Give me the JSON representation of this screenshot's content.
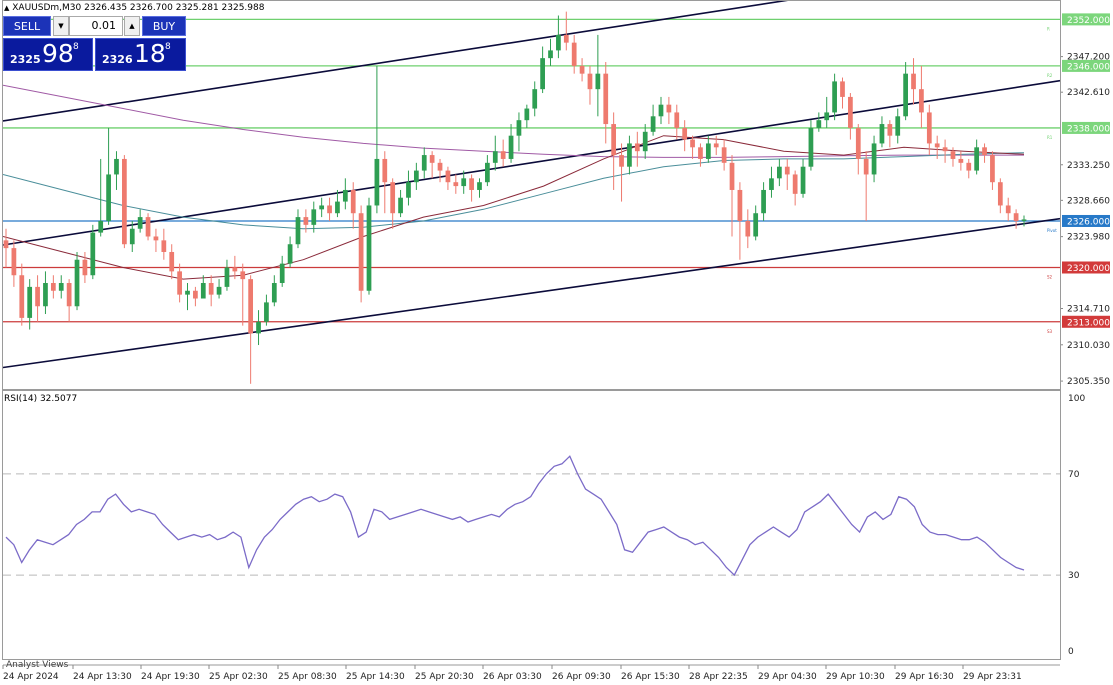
{
  "header": {
    "symbol_line": "XAUUSDm,M30  2326.435 2326.700 2325.281 2325.988"
  },
  "trade_panel": {
    "sell_label": "SELL",
    "buy_label": "BUY",
    "volume": "0.01",
    "sell_price_small": "2325",
    "sell_price_big": "98",
    "sell_price_sup": "8",
    "buy_price_small": "2326",
    "buy_price_big": "18",
    "buy_price_sup": "8"
  },
  "rsi_title": "RSI(14) 32.5077",
  "footer": {
    "analyst_views": "Analyst Views"
  },
  "colors": {
    "bull": "#2e9e52",
    "bear": "#ee7a6e",
    "channel": "#0b0b3a",
    "resistance": "#6fd06f",
    "current": "#2779c8",
    "support": "#cc3b3b",
    "ma_purple": "#a05aa5",
    "ma_maroon": "#8a2a3a",
    "ma_teal": "#4a8e9a",
    "rsi": "#7b6bc8",
    "label_current_bg": "#2779c8",
    "label_resistance_bg": "#7cd67c",
    "label_support_bg": "#d23a3a"
  },
  "chart_data": {
    "type": "candlestick",
    "symbol": "XAUUSDm",
    "timeframe": "M30",
    "price_axis": {
      "ticks": [
        2347.2,
        2342.61,
        2333.25,
        2328.66,
        2323.98,
        2314.71,
        2310.03,
        2305.35
      ],
      "ylim": [
        2304.2,
        2354.5
      ]
    },
    "x_ticks": [
      "24 Apr 2024",
      "24 Apr 13:30",
      "24 Apr 19:30",
      "25 Apr 02:30",
      "25 Apr 08:30",
      "25 Apr 14:30",
      "25 Apr 20:30",
      "26 Apr 03:30",
      "26 Apr 09:30",
      "26 Apr 15:30",
      "28 Apr 22:35",
      "29 Apr 04:30",
      "29 Apr 10:30",
      "29 Apr 16:30",
      "29 Apr 23:31"
    ],
    "horizontal_levels": [
      {
        "price": 2352.0,
        "label": "2352.000",
        "kind": "resistance",
        "tag": "R"
      },
      {
        "price": 2346.0,
        "label": "2346.000",
        "kind": "resistance",
        "tag": "R2"
      },
      {
        "price": 2338.0,
        "label": "2338.000",
        "kind": "resistance",
        "tag": "R1"
      },
      {
        "price": 2326.0,
        "label": "2326.000",
        "kind": "current",
        "tag": "Pivot"
      },
      {
        "price": 2320.0,
        "label": "2320.000",
        "kind": "support",
        "tag": "S2"
      },
      {
        "price": 2313.0,
        "label": "2313.000",
        "kind": "support",
        "tag": "S3"
      }
    ],
    "channel_lines": [
      {
        "x0": 0,
        "p0": 2338.9,
        "x1": 165,
        "p1": 2355.3
      },
      {
        "x0": 0,
        "p0": 2322.9,
        "x1": 211,
        "p1": 2344.1
      },
      {
        "x0": 0,
        "p0": 2307.1,
        "x1": 211,
        "p1": 2326.3
      }
    ],
    "candles": [
      [
        2323.5,
        2322.5,
        2325.0,
        2320.0
      ],
      [
        2322.5,
        2319.0,
        2323.5,
        2317.5
      ],
      [
        2319.0,
        2313.5,
        2320.5,
        2312.5
      ],
      [
        2313.5,
        2317.5,
        2318.5,
        2312.0
      ],
      [
        2317.5,
        2315.0,
        2319.0,
        2313.0
      ],
      [
        2315.0,
        2318.0,
        2319.5,
        2314.0
      ],
      [
        2318.0,
        2317.0,
        2319.0,
        2316.0
      ],
      [
        2317.0,
        2318.0,
        2319.0,
        2316.0
      ],
      [
        2318.0,
        2315.0,
        2318.5,
        2313.0
      ],
      [
        2315.0,
        2321.0,
        2322.0,
        2314.5
      ],
      [
        2321.0,
        2319.0,
        2322.0,
        2318.0
      ],
      [
        2319.0,
        2324.5,
        2325.5,
        2318.5
      ],
      [
        2324.5,
        2326.0,
        2334.0,
        2324.0
      ],
      [
        2326.0,
        2332.0,
        2338.0,
        2325.5
      ],
      [
        2332.0,
        2334.0,
        2335.0,
        2330.0
      ],
      [
        2334.0,
        2323.0,
        2334.5,
        2322.5
      ],
      [
        2323.0,
        2325.0,
        2326.0,
        2322.0
      ],
      [
        2325.0,
        2326.5,
        2327.5,
        2324.5
      ],
      [
        2326.5,
        2324.0,
        2327.0,
        2323.5
      ],
      [
        2324.0,
        2323.5,
        2325.0,
        2322.0
      ],
      [
        2323.5,
        2322.0,
        2325.0,
        2321.0
      ],
      [
        2322.0,
        2319.5,
        2323.0,
        2318.5
      ],
      [
        2319.5,
        2316.5,
        2320.5,
        2315.5
      ],
      [
        2316.5,
        2317.0,
        2318.0,
        2314.5
      ],
      [
        2317.0,
        2316.0,
        2317.5,
        2315.0
      ],
      [
        2316.0,
        2318.0,
        2319.0,
        2316.0
      ],
      [
        2318.0,
        2316.5,
        2319.0,
        2315.0
      ],
      [
        2316.5,
        2317.5,
        2318.5,
        2316.0
      ],
      [
        2317.5,
        2320.0,
        2321.0,
        2317.0
      ],
      [
        2320.0,
        2319.5,
        2321.5,
        2318.5
      ],
      [
        2319.5,
        2318.5,
        2320.5,
        2312.5
      ],
      [
        2318.5,
        2311.5,
        2319.0,
        2305.0
      ],
      [
        2311.5,
        2313.0,
        2314.5,
        2310.0
      ],
      [
        2313.0,
        2315.5,
        2316.5,
        2312.5
      ],
      [
        2315.5,
        2318.0,
        2319.0,
        2315.0
      ],
      [
        2318.0,
        2320.5,
        2321.5,
        2317.5
      ],
      [
        2320.5,
        2323.0,
        2324.0,
        2320.0
      ],
      [
        2323.0,
        2326.5,
        2327.5,
        2322.5
      ],
      [
        2326.5,
        2325.5,
        2327.5,
        2324.5
      ],
      [
        2325.5,
        2327.5,
        2328.5,
        2324.5
      ],
      [
        2327.5,
        2328.0,
        2329.0,
        2326.5
      ],
      [
        2328.0,
        2327.0,
        2329.0,
        2326.0
      ],
      [
        2327.0,
        2328.5,
        2330.0,
        2326.5
      ],
      [
        2328.5,
        2330.0,
        2331.5,
        2327.5
      ],
      [
        2330.0,
        2327.0,
        2331.0,
        2325.0
      ],
      [
        2327.0,
        2317.0,
        2328.0,
        2315.5
      ],
      [
        2317.0,
        2328.0,
        2329.0,
        2316.5
      ],
      [
        2328.0,
        2334.0,
        2346.0,
        2327.0
      ],
      [
        2334.0,
        2331.0,
        2335.0,
        2327.0
      ],
      [
        2331.0,
        2327.0,
        2331.5,
        2325.0
      ],
      [
        2327.0,
        2329.0,
        2330.0,
        2326.5
      ],
      [
        2329.0,
        2331.0,
        2332.5,
        2328.0
      ],
      [
        2331.0,
        2332.5,
        2333.5,
        2330.0
      ],
      [
        2332.5,
        2334.5,
        2335.5,
        2331.5
      ],
      [
        2334.5,
        2333.5,
        2335.0,
        2331.5
      ],
      [
        2333.5,
        2332.5,
        2334.0,
        2331.0
      ],
      [
        2332.5,
        2331.0,
        2333.0,
        2330.0
      ],
      [
        2331.0,
        2330.5,
        2332.0,
        2329.5
      ],
      [
        2330.5,
        2331.5,
        2332.5,
        2329.5
      ],
      [
        2331.5,
        2330.0,
        2332.0,
        2328.5
      ],
      [
        2330.0,
        2331.0,
        2331.5,
        2329.0
      ],
      [
        2331.0,
        2333.5,
        2334.5,
        2330.5
      ],
      [
        2333.5,
        2335.0,
        2337.0,
        2332.5
      ],
      [
        2335.0,
        2334.0,
        2336.5,
        2333.0
      ],
      [
        2334.0,
        2337.0,
        2338.5,
        2333.5
      ],
      [
        2337.0,
        2339.0,
        2340.0,
        2335.0
      ],
      [
        2339.0,
        2340.5,
        2341.0,
        2338.0
      ],
      [
        2340.5,
        2343.0,
        2344.0,
        2339.5
      ],
      [
        2343.0,
        2347.0,
        2348.5,
        2342.5
      ],
      [
        2347.0,
        2348.0,
        2349.5,
        2346.0
      ],
      [
        2348.0,
        2350.0,
        2352.5,
        2347.0
      ],
      [
        2350.0,
        2349.0,
        2353.0,
        2348.0
      ],
      [
        2349.0,
        2346.0,
        2350.0,
        2345.0
      ],
      [
        2346.0,
        2345.0,
        2347.0,
        2344.0
      ],
      [
        2345.0,
        2343.0,
        2346.0,
        2341.0
      ],
      [
        2343.0,
        2345.0,
        2350.0,
        2339.5
      ],
      [
        2345.0,
        2338.5,
        2346.5,
        2336.0
      ],
      [
        2338.5,
        2334.5,
        2340.0,
        2330.0
      ],
      [
        2334.5,
        2333.0,
        2336.0,
        2328.5
      ],
      [
        2333.0,
        2336.0,
        2337.0,
        2332.0
      ],
      [
        2336.0,
        2335.0,
        2337.5,
        2333.0
      ],
      [
        2335.0,
        2337.5,
        2338.5,
        2334.0
      ],
      [
        2337.5,
        2339.5,
        2341.0,
        2337.0
      ],
      [
        2339.5,
        2341.0,
        2342.0,
        2338.5
      ],
      [
        2341.0,
        2340.0,
        2342.0,
        2338.5
      ],
      [
        2340.0,
        2338.0,
        2341.0,
        2336.5
      ],
      [
        2338.0,
        2336.5,
        2339.0,
        2335.0
      ],
      [
        2336.5,
        2335.5,
        2337.0,
        2334.0
      ],
      [
        2335.5,
        2334.0,
        2336.0,
        2333.0
      ],
      [
        2334.0,
        2336.0,
        2337.0,
        2333.5
      ],
      [
        2336.0,
        2335.5,
        2337.0,
        2334.5
      ],
      [
        2335.5,
        2333.5,
        2336.5,
        2332.5
      ],
      [
        2333.5,
        2330.0,
        2334.5,
        2324.0
      ],
      [
        2330.0,
        2326.0,
        2331.0,
        2321.0
      ],
      [
        2326.0,
        2324.0,
        2327.5,
        2322.5
      ],
      [
        2324.0,
        2327.0,
        2328.0,
        2323.5
      ],
      [
        2327.0,
        2330.0,
        2331.0,
        2326.0
      ],
      [
        2330.0,
        2331.5,
        2333.0,
        2329.0
      ],
      [
        2331.5,
        2333.0,
        2334.0,
        2330.5
      ],
      [
        2333.0,
        2332.0,
        2334.0,
        2330.0
      ],
      [
        2332.0,
        2329.5,
        2332.5,
        2328.0
      ],
      [
        2329.5,
        2333.0,
        2334.0,
        2329.0
      ],
      [
        2333.0,
        2338.0,
        2339.0,
        2332.5
      ],
      [
        2338.0,
        2339.0,
        2340.0,
        2337.5
      ],
      [
        2339.0,
        2340.0,
        2342.0,
        2338.0
      ],
      [
        2340.0,
        2344.0,
        2345.0,
        2339.0
      ],
      [
        2344.0,
        2342.0,
        2344.5,
        2340.5
      ],
      [
        2342.0,
        2338.0,
        2342.5,
        2336.5
      ],
      [
        2338.0,
        2334.0,
        2338.5,
        2332.0
      ],
      [
        2334.0,
        2332.0,
        2335.0,
        2326.0
      ],
      [
        2332.0,
        2336.0,
        2337.0,
        2331.0
      ],
      [
        2336.0,
        2338.5,
        2339.5,
        2335.5
      ],
      [
        2338.5,
        2337.0,
        2339.0,
        2335.5
      ],
      [
        2337.0,
        2339.5,
        2340.5,
        2336.0
      ],
      [
        2339.5,
        2345.0,
        2346.5,
        2339.0
      ],
      [
        2345.0,
        2343.0,
        2347.0,
        2341.0
      ],
      [
        2343.0,
        2340.0,
        2346.0,
        2338.0
      ],
      [
        2340.0,
        2336.0,
        2341.0,
        2334.5
      ],
      [
        2336.0,
        2335.5,
        2337.0,
        2334.0
      ],
      [
        2335.5,
        2335.0,
        2336.5,
        2333.5
      ],
      [
        2335.0,
        2334.0,
        2335.5,
        2333.0
      ],
      [
        2334.0,
        2333.5,
        2335.0,
        2332.5
      ],
      [
        2333.5,
        2332.5,
        2334.0,
        2331.5
      ],
      [
        2332.5,
        2335.5,
        2336.5,
        2332.0
      ],
      [
        2335.5,
        2334.5,
        2336.0,
        2333.5
      ],
      [
        2334.5,
        2331.0,
        2335.0,
        2330.0
      ],
      [
        2331.0,
        2328.0,
        2331.5,
        2327.0
      ],
      [
        2328.0,
        2327.0,
        2329.0,
        2326.0
      ],
      [
        2327.0,
        2326.0,
        2327.5,
        2325.0
      ],
      [
        2326.0,
        2326.2,
        2326.7,
        2325.3
      ]
    ],
    "moving_averages": [
      {
        "color_key": "ma_purple",
        "values": [
          2343.5,
          2342.0,
          2340.5,
          2339.0,
          2337.8,
          2336.8,
          2336.0,
          2335.4,
          2335.0,
          2334.6,
          2334.3,
          2334.2,
          2334.2,
          2334.3,
          2334.4,
          2334.5,
          2334.5,
          2334.5
        ]
      },
      {
        "color_key": "ma_teal",
        "values": [
          2332.0,
          2330.0,
          2328.0,
          2326.5,
          2325.5,
          2325.0,
          2325.2,
          2326.0,
          2327.5,
          2329.5,
          2331.5,
          2333.0,
          2333.8,
          2334.0,
          2334.0,
          2334.3,
          2334.6,
          2334.8
        ]
      },
      {
        "color_key": "ma_maroon",
        "values": [
          2324.0,
          2322.0,
          2320.0,
          2318.5,
          2319.0,
          2321.0,
          2324.0,
          2326.5,
          2328.0,
          2330.5,
          2334.0,
          2337.0,
          2336.5,
          2335.0,
          2334.5,
          2335.5,
          2335.0,
          2334.6
        ]
      }
    ],
    "rsi": {
      "title": "RSI(14) 32.5077",
      "period": 14,
      "last": 32.5077,
      "ylim": [
        0,
        100
      ],
      "levels": [
        70,
        30
      ],
      "axis_ticks": [
        100,
        70,
        30,
        0
      ],
      "values": [
        45,
        42,
        35,
        40,
        44,
        43,
        42,
        44,
        46,
        50,
        52,
        55,
        55,
        60,
        62,
        58,
        55,
        56,
        55,
        54,
        50,
        47,
        44,
        45,
        46,
        45,
        46,
        44,
        45,
        47,
        45,
        33,
        40,
        45,
        48,
        52,
        55,
        58,
        60,
        61,
        59,
        60,
        62,
        61,
        55,
        45,
        47,
        56,
        55,
        52,
        53,
        54,
        55,
        56,
        55,
        54,
        53,
        52,
        53,
        51,
        52,
        53,
        54,
        53,
        56,
        58,
        59,
        61,
        66,
        70,
        73,
        74,
        77,
        70,
        64,
        62,
        60,
        55,
        50,
        40,
        39,
        43,
        47,
        48,
        49,
        47,
        45,
        44,
        42,
        43,
        40,
        37,
        33,
        30,
        36,
        42,
        45,
        47,
        49,
        47,
        45,
        48,
        55,
        57,
        59,
        62,
        58,
        54,
        50,
        47,
        53,
        55,
        52,
        54,
        61,
        60,
        57,
        50,
        47,
        46,
        46,
        45,
        44,
        44,
        45,
        43,
        40,
        37,
        35,
        33,
        32
      ]
    }
  }
}
